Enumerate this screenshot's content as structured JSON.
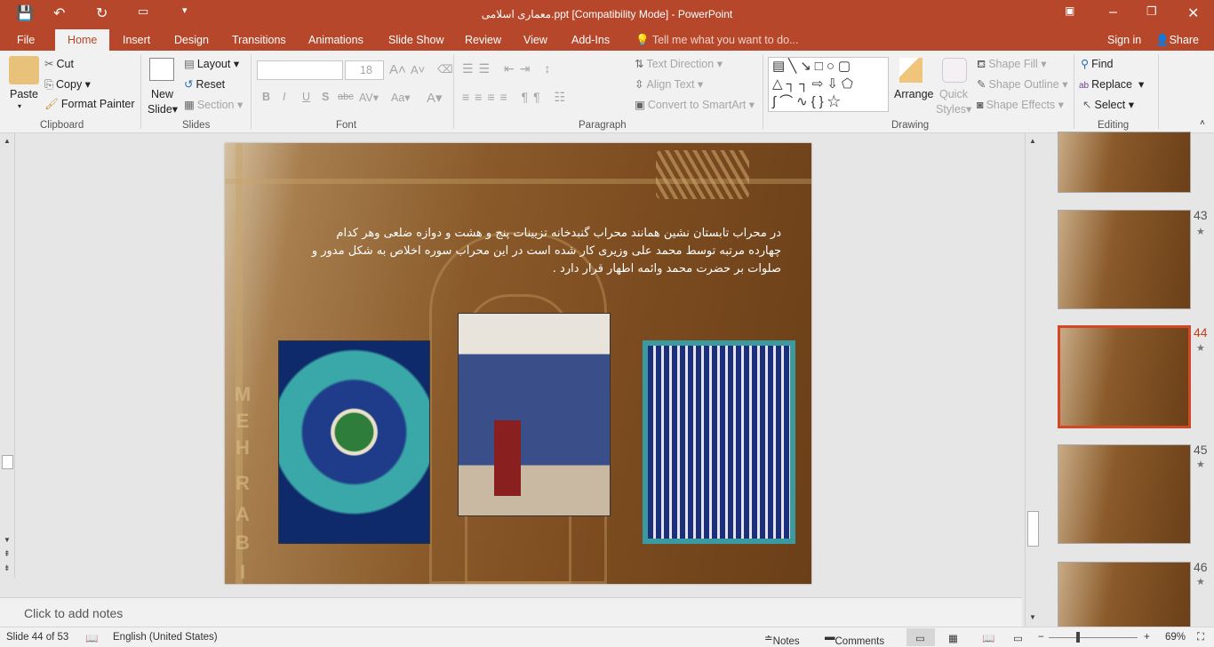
{
  "title_bar": {
    "title": "معماری اسلامی.ppt [Compatibility Mode] - PowerPoint",
    "save_icon": "save-icon",
    "undo_icon": "undo-icon",
    "redo_icon": "redo-icon"
  },
  "tabs": [
    "File",
    "Home",
    "Insert",
    "Design",
    "Transitions",
    "Animations",
    "Slide Show",
    "Review",
    "View",
    "Add-Ins"
  ],
  "tell_me": "Tell me what you want to do...",
  "sign_in": "Sign in",
  "share": "Share",
  "ribbon": {
    "clipboard": {
      "paste": "Paste",
      "cut": "Cut",
      "copy": "Copy",
      "format_painter": "Format Painter",
      "label": "Clipboard"
    },
    "slides": {
      "new_slide": "New",
      "new_slide2": "Slide",
      "layout": "Layout",
      "reset": "Reset",
      "section": "Section",
      "label": "Slides"
    },
    "font": {
      "font_name": "",
      "font_size": "18",
      "label": "Font"
    },
    "paragraph": {
      "text_direction": "Text Direction",
      "align_text": "Align Text",
      "smartart": "Convert to SmartArt",
      "label": "Paragraph"
    },
    "drawing": {
      "arrange": "Arrange",
      "quick_styles": "Quick",
      "quick_styles2": "Styles",
      "shape_fill": "Shape Fill",
      "shape_outline": "Shape Outline",
      "shape_effects": "Shape Effects",
      "label": "Drawing"
    },
    "editing": {
      "find": "Find",
      "replace": "Replace",
      "select": "Select",
      "label": "Editing"
    }
  },
  "slide": {
    "text": "در محراب تابستان نشین همانند محراب گنبدخانه تزیینات پنج و هشت و دوازه ضلعی وهر کدام چهارده مرتبه توسط محمد علی وزیری کار شده است در این محراب سوره اخلاص به شکل مدور و صلوات بر حضرت محمد وائمه اطهار قرار دارد .",
    "vertical_letters": [
      "M",
      "E",
      "H",
      "R",
      "A",
      "B",
      "I"
    ]
  },
  "thumbnails": [
    {
      "number": "43"
    },
    {
      "number": "44",
      "selected": true
    },
    {
      "number": "45"
    },
    {
      "number": "46"
    }
  ],
  "notes_placeholder": "Click to add notes",
  "status": {
    "slide_info": "Slide 44 of 53",
    "language": "English (United States)",
    "notes": "Notes",
    "comments": "Comments",
    "zoom": "69%",
    "zoom_level_percent": 69
  }
}
